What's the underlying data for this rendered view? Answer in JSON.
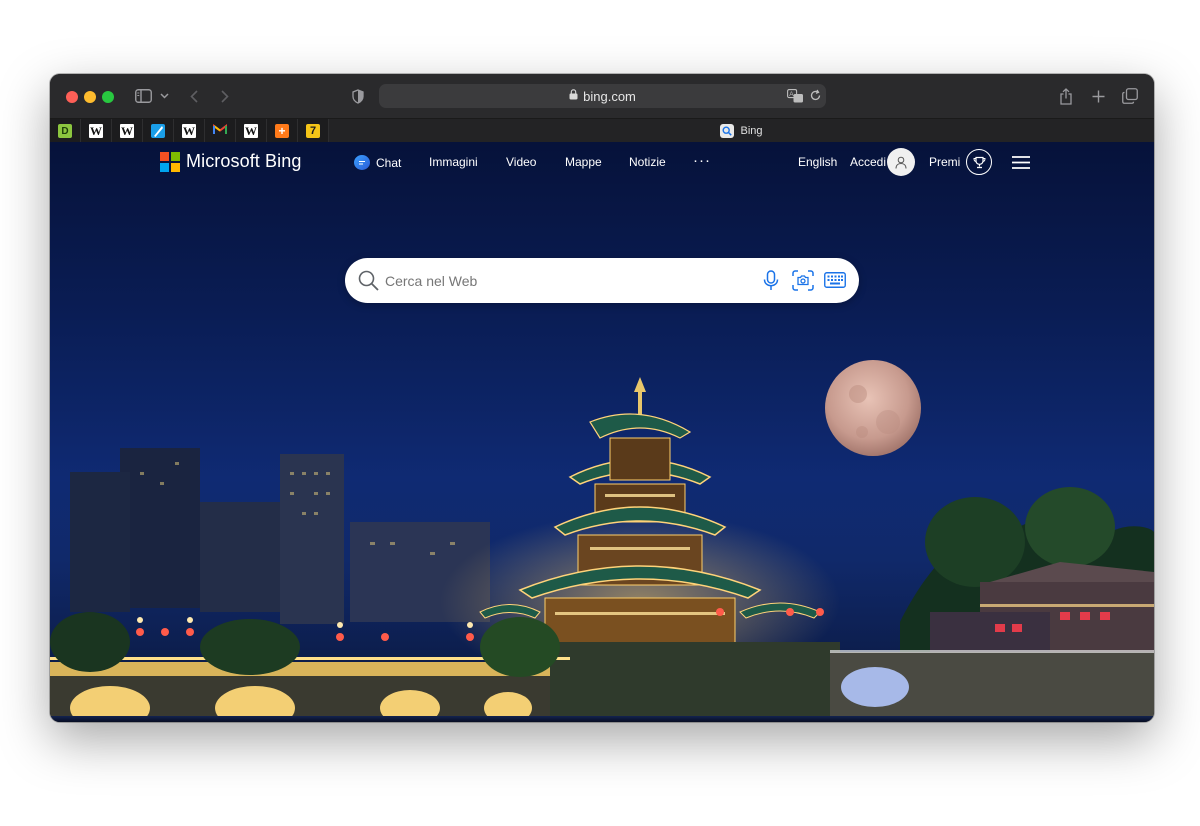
{
  "browser": {
    "address": "bing.com",
    "tab_title": "Bing",
    "favorites": [
      {
        "icon": "devonthink-icon",
        "glyph": "D",
        "bg": "#8cc63f",
        "fg": "#1c3d0a"
      },
      {
        "icon": "wikipedia-icon",
        "glyph": "W"
      },
      {
        "icon": "wikipedia-icon",
        "glyph": "W"
      },
      {
        "icon": "bookmark-app-icon",
        "glyph": ""
      },
      {
        "icon": "wikipedia-icon",
        "glyph": "W"
      },
      {
        "icon": "gmail-icon",
        "glyph": "M"
      },
      {
        "icon": "wikipedia-icon",
        "glyph": "W"
      },
      {
        "icon": "orange-app-icon",
        "glyph": "+"
      },
      {
        "icon": "yellow-app-icon",
        "glyph": "7"
      }
    ]
  },
  "bing": {
    "logo_text": "Microsoft Bing",
    "nav": {
      "chat": "Chat",
      "images": "Immagini",
      "video": "Video",
      "maps": "Mappe",
      "news": "Notizie",
      "more": "···"
    },
    "language": "English",
    "signin": "Accedi",
    "rewards": "Premi",
    "search_placeholder": "Cerca nel Web"
  },
  "colors": {
    "red": "#fe5f57",
    "yellow": "#febc2e",
    "green": "#28c840",
    "ms_red": "#f25022",
    "ms_green": "#7fba00",
    "ms_blue": "#00a4ef",
    "ms_yellow": "#ffb900",
    "sky_top": "#06123a",
    "accent": "#1a73e8"
  }
}
